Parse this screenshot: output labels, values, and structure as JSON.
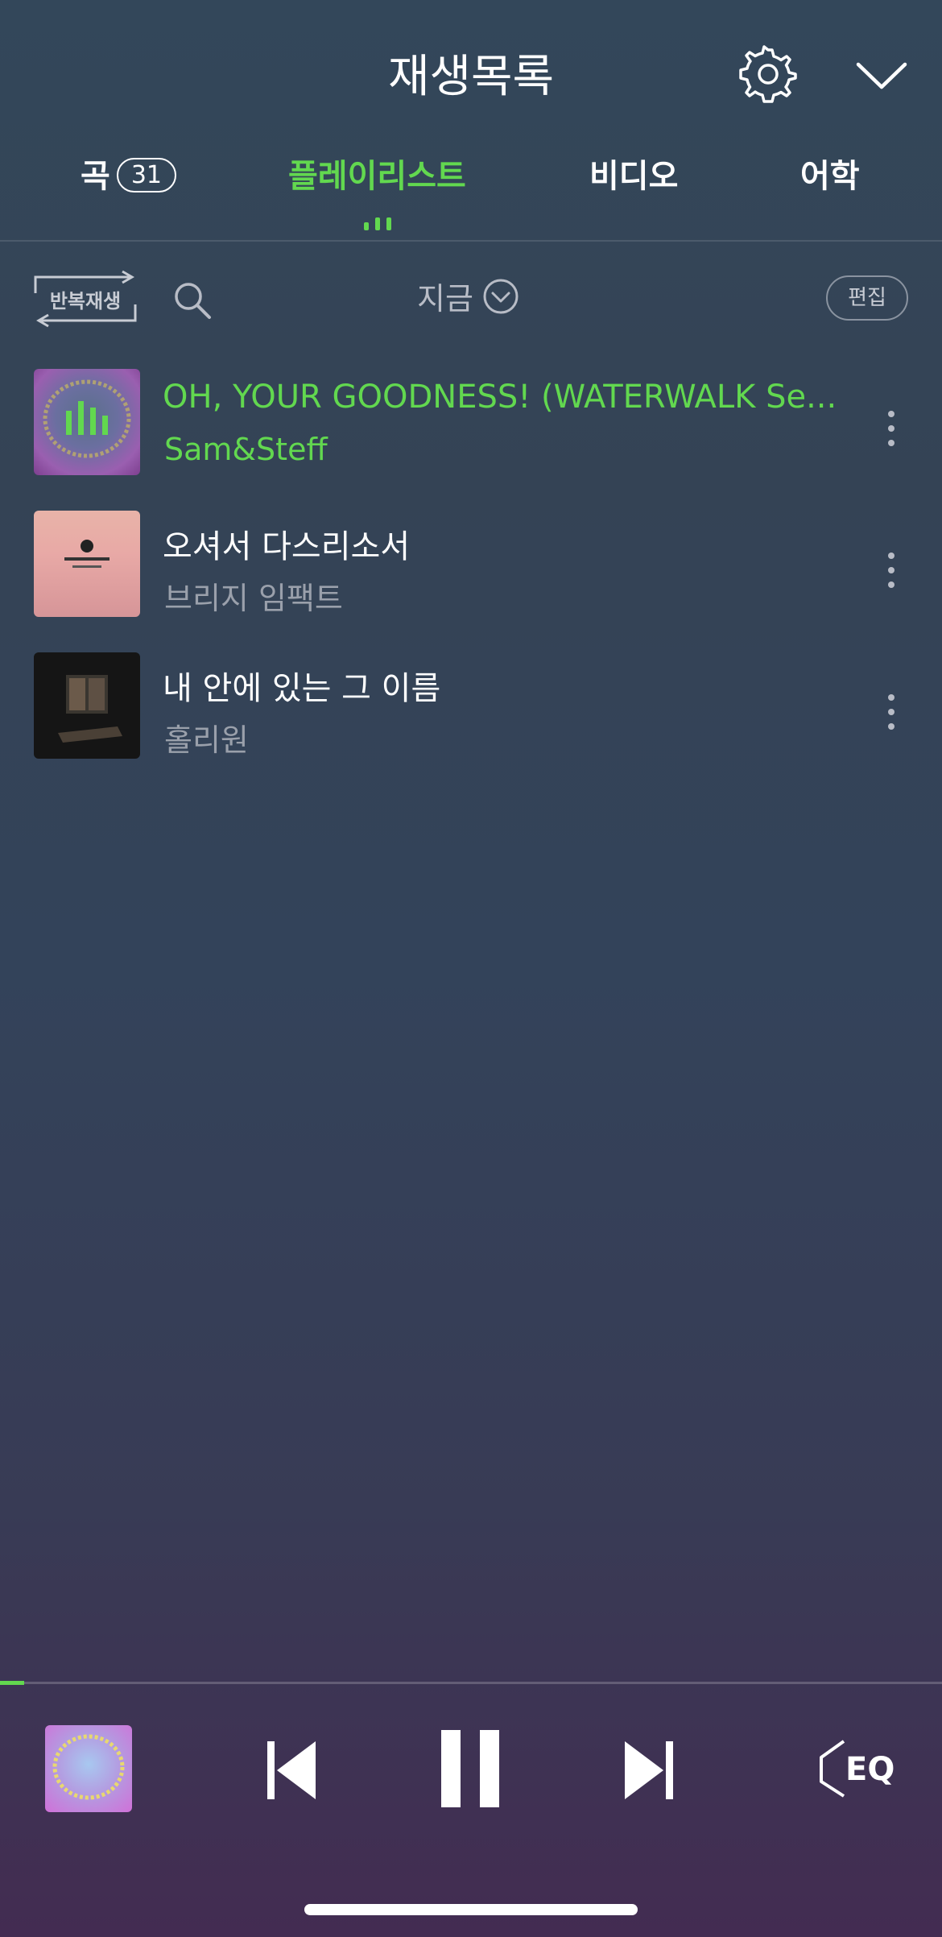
{
  "header": {
    "title": "재생목록",
    "settings_icon": "gear-icon",
    "collapse_icon": "chevron-down-icon"
  },
  "tabs": [
    {
      "label": "곡",
      "count": "31"
    },
    {
      "label": "플레이리스트"
    },
    {
      "label": "비디오"
    },
    {
      "label": "어학"
    }
  ],
  "toolbar": {
    "repeat_label": "반복재생",
    "sort_label": "지금",
    "edit_label": "편집"
  },
  "songs": [
    {
      "title": "OH, YOUR GOODNESS! (WATERWALK Se...",
      "artist": "Sam&Steff",
      "playing": true
    },
    {
      "title": "오셔서 다스리소서",
      "artist": "브리지 임팩트",
      "playing": false
    },
    {
      "title": "내 안에 있는 그 이름",
      "artist": "홀리원",
      "playing": false
    }
  ],
  "player": {
    "progress": 0.026,
    "eq_label": "EQ"
  },
  "colors": {
    "accent": "#62d84f",
    "text_muted": "#9aa0ab",
    "background_top": "#33475a",
    "background_bottom": "#432c52"
  }
}
